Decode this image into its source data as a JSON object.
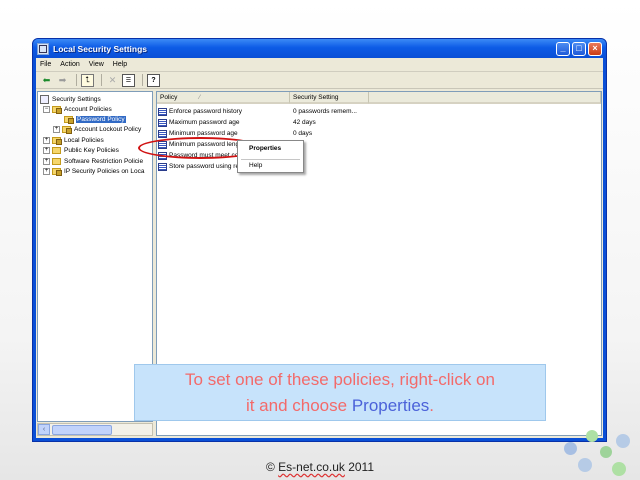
{
  "window": {
    "title": "Local Security Settings",
    "controls": {
      "minimize": "_",
      "maximize": "□",
      "close": "×"
    }
  },
  "menu": [
    "File",
    "Action",
    "View",
    "Help"
  ],
  "toolbar_icons": [
    "back-arrow-icon",
    "forward-arrow-icon",
    "up-folder-icon",
    "delete-icon",
    "properties-icon",
    "help-icon"
  ],
  "tree": {
    "root": "Security Settings",
    "items": [
      {
        "label": "Account Policies",
        "expander": "−"
      },
      {
        "label": "Password Policy",
        "selected": true
      },
      {
        "label": "Account Lockout Policy",
        "expander": "+"
      },
      {
        "label": "Local Policies",
        "expander": "+"
      },
      {
        "label": "Public Key Policies",
        "expander": "+"
      },
      {
        "label": "Software Restriction Policie",
        "expander": "+"
      },
      {
        "label": "IP Security Policies on Loca",
        "expander": "+"
      }
    ]
  },
  "list": {
    "columns": [
      "Policy",
      "Security Setting"
    ],
    "sort_indicator": "⁄",
    "rows": [
      {
        "policy": "Enforce password history",
        "setting": "0 passwords remem..."
      },
      {
        "policy": "Maximum password age",
        "setting": "42 days"
      },
      {
        "policy": "Minimum password age",
        "setting": "0 days"
      },
      {
        "policy": "Minimum password length",
        "setting": ""
      },
      {
        "policy": "Password must meet complexity",
        "setting": ""
      },
      {
        "policy": "Store password using reversible",
        "setting": ""
      }
    ]
  },
  "context_menu": {
    "properties": "Properties",
    "help": "Help"
  },
  "callout": {
    "line1": "To set one of these policies, right-click on",
    "line2_prefix": "it and choose ",
    "line2_highlight": "Properties",
    "line2_suffix": "."
  },
  "footer": {
    "prefix": "© ",
    "brand": "Es-net.co.uk",
    "suffix": " 2011"
  },
  "colors": {
    "accent": "#0a4fd6",
    "callout_text": "#f36a6a",
    "callout_highlight": "#4b62d9",
    "ellipse": "#d01212"
  }
}
